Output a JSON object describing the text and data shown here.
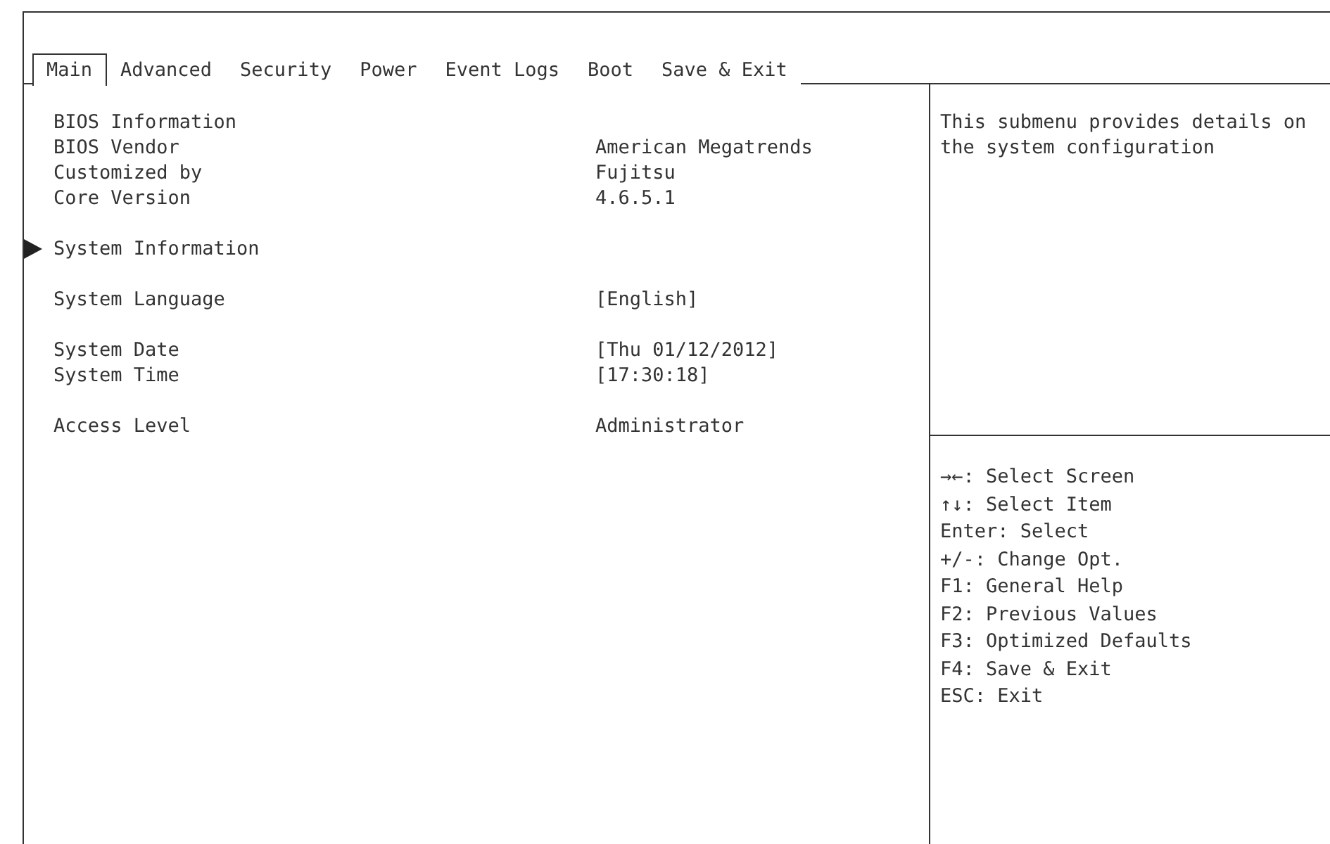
{
  "tabs": [
    {
      "label": "Main",
      "selected": true
    },
    {
      "label": "Advanced",
      "selected": false
    },
    {
      "label": "Security",
      "selected": false
    },
    {
      "label": "Power",
      "selected": false
    },
    {
      "label": "Event Logs",
      "selected": false
    },
    {
      "label": "Boot",
      "selected": false
    },
    {
      "label": "Save & Exit",
      "selected": false
    }
  ],
  "groups": [
    [
      {
        "kind": "info",
        "label": "BIOS Information"
      },
      {
        "kind": "info",
        "label": "BIOS Vendor",
        "value": "American Megatrends"
      },
      {
        "kind": "info",
        "label": "Customized by",
        "value": "Fujitsu"
      },
      {
        "kind": "info",
        "label": "Core Version",
        "value": "4.6.5.1"
      }
    ],
    [
      {
        "kind": "submenu",
        "label": "System Information"
      }
    ],
    [
      {
        "kind": "setting",
        "label": "System Language",
        "value": "[English]"
      }
    ],
    [
      {
        "kind": "setting",
        "label": "System Date",
        "value": "[Thu 01/12/2012]"
      },
      {
        "kind": "setting",
        "label": "System Time",
        "value": "[17:30:18]"
      }
    ],
    [
      {
        "kind": "info",
        "label": "Access Level",
        "value": "Administrator"
      }
    ]
  ],
  "help": "This submenu provides details on the system configuration",
  "keys": [
    "→←: Select Screen",
    "↑↓: Select Item",
    "Enter: Select",
    "+/-: Change Opt.",
    "F1: General Help",
    "F2: Previous Values",
    "F3: Optimized Defaults",
    "F4: Save & Exit",
    "ESC: Exit"
  ]
}
